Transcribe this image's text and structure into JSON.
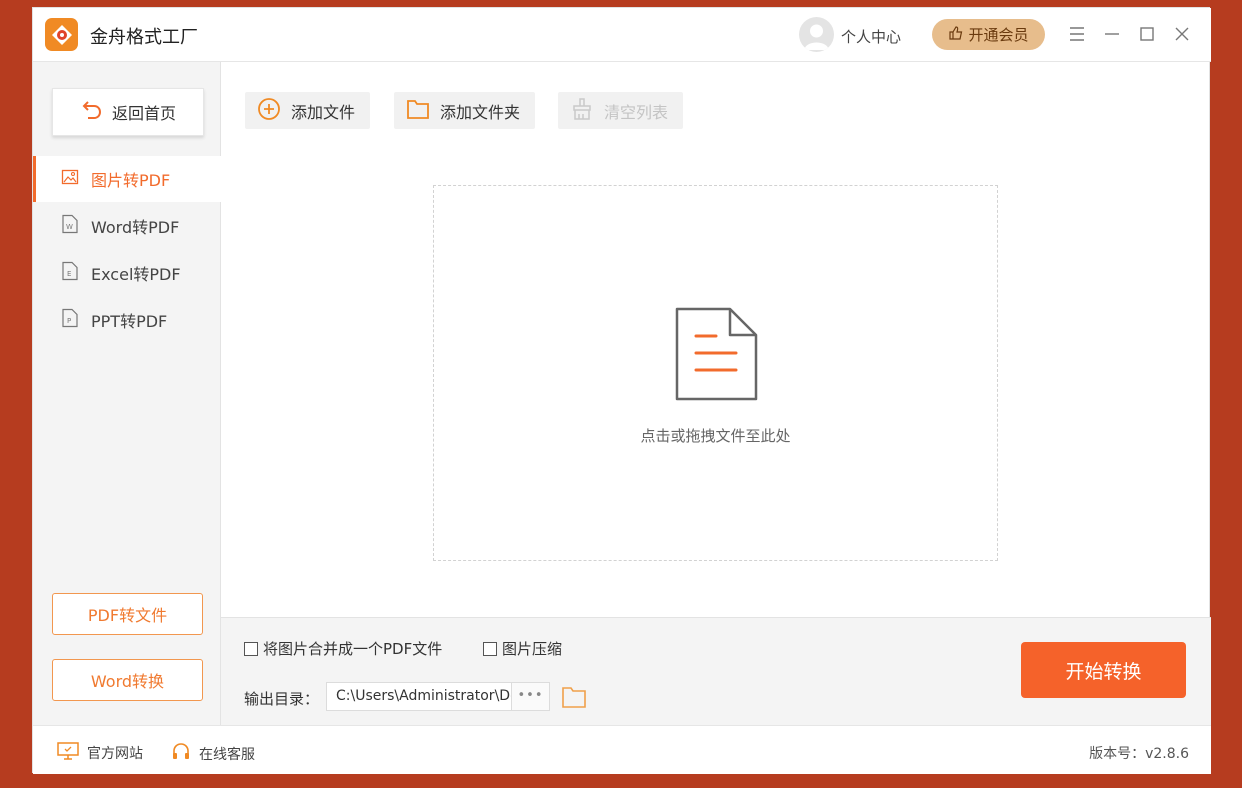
{
  "app": {
    "title": "金舟格式工厂"
  },
  "header": {
    "user_center": "个人中心",
    "vip_button": "开通会员"
  },
  "sidebar": {
    "back_button": "返回首页",
    "items": [
      {
        "label": "图片转PDF",
        "icon": "image-file-icon",
        "active": true
      },
      {
        "label": "Word转PDF",
        "icon": "word-file-icon",
        "active": false
      },
      {
        "label": "Excel转PDF",
        "icon": "excel-file-icon",
        "active": false
      },
      {
        "label": "PPT转PDF",
        "icon": "ppt-file-icon",
        "active": false
      }
    ],
    "pdf_to_file": "PDF转文件",
    "word_convert": "Word转换"
  },
  "toolbar": {
    "add_file": "添加文件",
    "add_folder": "添加文件夹",
    "clear_list": "清空列表"
  },
  "dropzone": {
    "text": "点击或拖拽文件至此处"
  },
  "options": {
    "merge_pdf": "将图片合并成一个PDF文件",
    "compress_image": "图片压缩",
    "merge_checked": false,
    "compress_checked": false
  },
  "output": {
    "label": "输出目录：",
    "path": "C:\\Users\\Administrator\\Desktop",
    "more": "•••"
  },
  "actions": {
    "start": "开始转换"
  },
  "footer": {
    "website": "官方网站",
    "support": "在线客服",
    "version": "版本号：v2.8.6"
  },
  "colors": {
    "accent": "#f26b2c",
    "start_button": "#f5622a",
    "vip": "#e7bd8c",
    "background": "#b63c1f"
  }
}
